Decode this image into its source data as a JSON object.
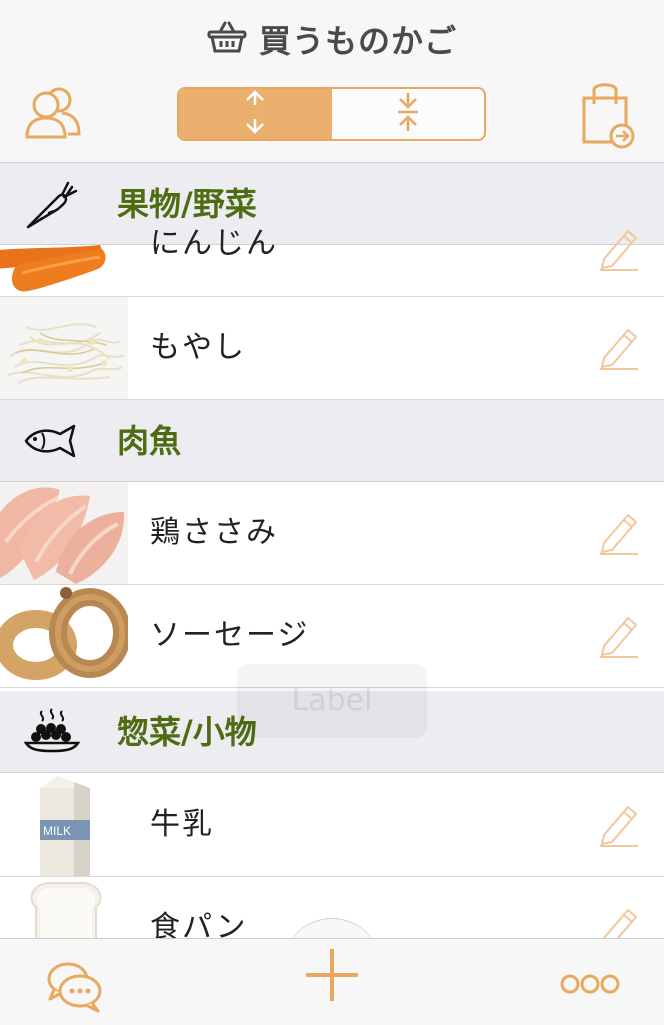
{
  "header": {
    "title": "買うものかご",
    "icons": {
      "basket": "basket-icon",
      "users": "users-icon",
      "expand": "expand-arrows-icon",
      "collapse": "collapse-arrows-icon",
      "bag": "shopping-bag-exit-icon"
    },
    "segment_selected": "expand"
  },
  "sections": [
    {
      "label": "果物/野菜",
      "icon": "carrot-icon",
      "items": [
        {
          "label": "にんじん",
          "image": "carrot-photo"
        },
        {
          "label": "もやし",
          "image": "bean-sprouts-photo"
        }
      ]
    },
    {
      "label": "肉魚",
      "icon": "fish-icon",
      "items": [
        {
          "label": "鶏ささみ",
          "image": "chicken-breast-photo"
        },
        {
          "label": "ソーセージ",
          "image": "sausage-photo"
        }
      ]
    },
    {
      "label": "惣菜/小物",
      "icon": "dish-icon",
      "items": [
        {
          "label": "牛乳",
          "image": "milk-carton-photo",
          "image_text": "MILK"
        },
        {
          "label": "食パン",
          "image": "bread-photo"
        }
      ]
    }
  ],
  "toast": {
    "text": "Label"
  },
  "footer": {
    "chat_icon": "chat-icon",
    "add_icon": "plus-icon",
    "more_icon": "more-icon"
  },
  "colors": {
    "accent": "#e8a860",
    "section_text": "#4e6d12",
    "section_bg": "#ececf1",
    "header_bg": "#f7f7f7"
  }
}
